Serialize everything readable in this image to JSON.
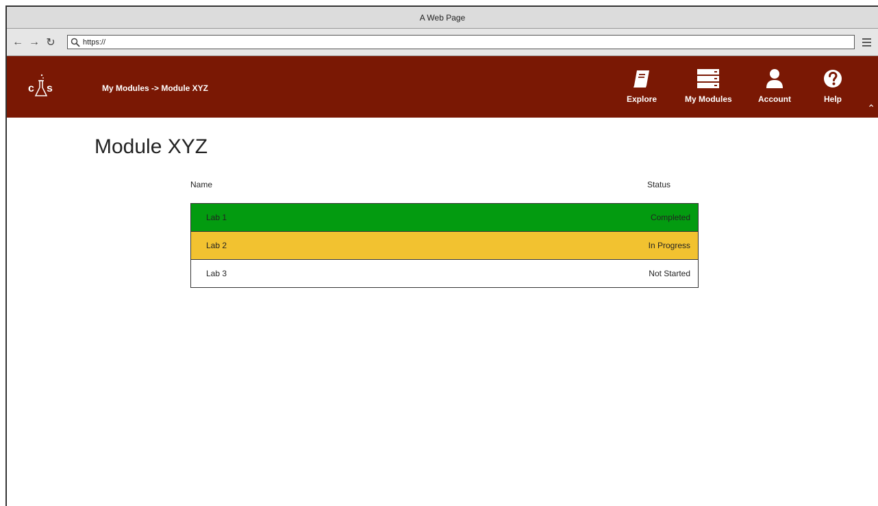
{
  "browser": {
    "title": "A Web Page",
    "url": "https://"
  },
  "header": {
    "logo_text": "CHS",
    "breadcrumb": "My Modules -> Module XYZ",
    "nav": [
      {
        "label": "Explore",
        "icon": "book-icon"
      },
      {
        "label": "My Modules",
        "icon": "server-list-icon"
      },
      {
        "label": "Account",
        "icon": "user-icon"
      },
      {
        "label": "Help",
        "icon": "question-icon"
      }
    ]
  },
  "main": {
    "title": "Module XYZ",
    "columns": {
      "name": "Name",
      "status": "Status"
    },
    "labs": [
      {
        "name": "Lab 1",
        "status": "Completed",
        "color": "#039b10"
      },
      {
        "name": "Lab 2",
        "status": "In Progress",
        "color": "#f2c230"
      },
      {
        "name": "Lab 3",
        "status": "Not Started",
        "color": "#ffffff"
      }
    ]
  },
  "colors": {
    "header_bg": "#7a1804",
    "completed": "#039b10",
    "in_progress": "#f2c230",
    "not_started": "#ffffff"
  }
}
